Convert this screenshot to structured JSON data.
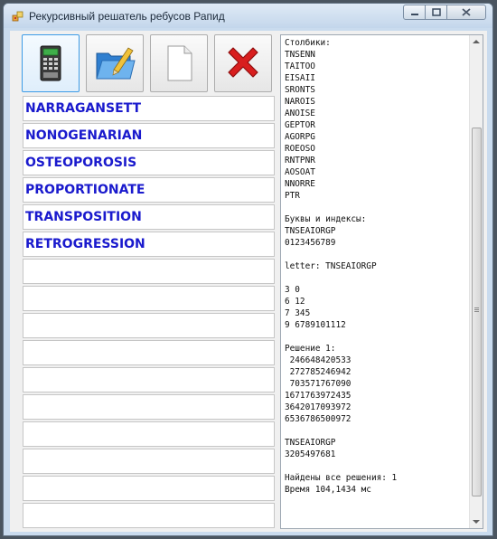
{
  "window": {
    "title": "Рекурсивный решатель ребусов Рапид"
  },
  "toolbar": {
    "buttons": [
      {
        "name": "calculator-button",
        "icon": "calculator-icon"
      },
      {
        "name": "open-folder-button",
        "icon": "folder-icon"
      },
      {
        "name": "new-document-button",
        "icon": "blank-document-icon"
      },
      {
        "name": "delete-button",
        "icon": "red-x-icon"
      }
    ]
  },
  "words": [
    "NARRAGANSETT",
    "NONOGENARIAN",
    "OSTEOPOROSIS",
    "PROPORTIONATE",
    "TRANSPOSITION",
    "RETROGRESSION",
    "",
    "",
    "",
    "",
    "",
    "",
    "",
    "",
    "",
    ""
  ],
  "output": {
    "lines": [
      "Столбики:",
      "TNSENN",
      "TAITOO",
      "EISAII",
      "SRONTS",
      "NAROIS",
      "ANOISE",
      "GEPTOR",
      "AGORPG",
      "ROEOSO",
      "RNTPNR",
      "AOSOAT",
      "NNORRE",
      "PTR",
      "",
      "Буквы и индексы:",
      "TNSEAIORGP",
      "0123456789",
      "",
      "letter: TNSEAIORGP",
      "",
      "3 0",
      "6 12",
      "7 345",
      "9 6789101112",
      "",
      "Решение 1:",
      " 246648420533",
      " 272785246942",
      " 703571767090",
      "1671763972435",
      "3642017093972",
      "6536786500972",
      "",
      "TNSEAIORGP",
      "3205497681",
      "",
      "Найдены все решения: 1",
      "Время 104,1434 мс"
    ]
  },
  "colors": {
    "word_text": "#1a1acd",
    "window_frame": "#c9dbee"
  }
}
